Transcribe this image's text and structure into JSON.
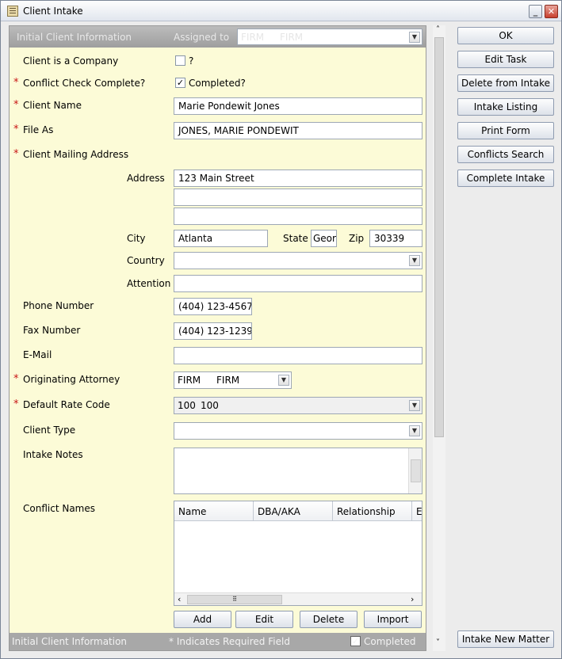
{
  "window": {
    "title": "Client Intake"
  },
  "panel": {
    "header_title": "Initial Client Information",
    "assigned_to_label": "Assigned to",
    "assigned_code": "FIRM",
    "assigned_name": "FIRM",
    "footer_title": "Initial Client Information",
    "footer_required_note": "* Indicates Required Field",
    "footer_completed_label": "Completed",
    "footer_completed_checked": "✓"
  },
  "form": {
    "required_mark": "*",
    "client_is_company_label": "Client is a Company",
    "client_is_company_q": "?",
    "conflict_check_label": "Conflict Check Complete?",
    "conflict_check_checkbox": "✓",
    "conflict_check_text": "Completed?",
    "client_name_label": "Client Name",
    "client_name_value": "Marie Pondewit Jones",
    "file_as_label": "File As",
    "file_as_value": "JONES, MARIE PONDEWIT",
    "mailing_address_label": "Client Mailing Address",
    "address_label": "Address",
    "address_line1": "123 Main Street",
    "address_line2": "",
    "address_line3": "",
    "city_label": "City",
    "city_value": "Atlanta",
    "state_label": "State",
    "state_value": "Geor",
    "zip_label": "Zip",
    "zip_value": "30339",
    "country_label": "Country",
    "country_value": "",
    "attention_label": "Attention",
    "attention_value": "",
    "phone_label": "Phone Number",
    "phone_value": "(404) 123-4567",
    "fax_label": "Fax Number",
    "fax_value": "(404) 123-1239",
    "email_label": "E-Mail",
    "email_value": "",
    "orig_atty_label": "Originating Attorney",
    "orig_atty_code": "FIRM",
    "orig_atty_name": "FIRM",
    "rate_code_label": "Default Rate Code",
    "rate_code_code": "100",
    "rate_code_name": "100",
    "client_type_label": "Client Type",
    "client_type_value": "",
    "intake_notes_label": "Intake Notes",
    "intake_notes_value": "",
    "conflict_names_label": "Conflict Names",
    "conflict_columns": [
      "Name",
      "DBA/AKA",
      "Relationship",
      "E"
    ],
    "hscroll_grip": "⠿",
    "buttons": {
      "add": "Add",
      "edit": "Edit",
      "delete": "Delete",
      "import": "Import"
    }
  },
  "sidebar": {
    "buttons": [
      "OK",
      "Edit Task",
      "Delete from Intake",
      "Intake Listing",
      "Print Form",
      "Conflicts Search",
      "Complete Intake"
    ],
    "intake_new_matter": "Intake New Matter"
  },
  "icons": {
    "dropdown": "chevron-down",
    "scroll_left": "‹",
    "scroll_right": "›",
    "scroll_up": "˄",
    "scroll_down": "˅"
  }
}
